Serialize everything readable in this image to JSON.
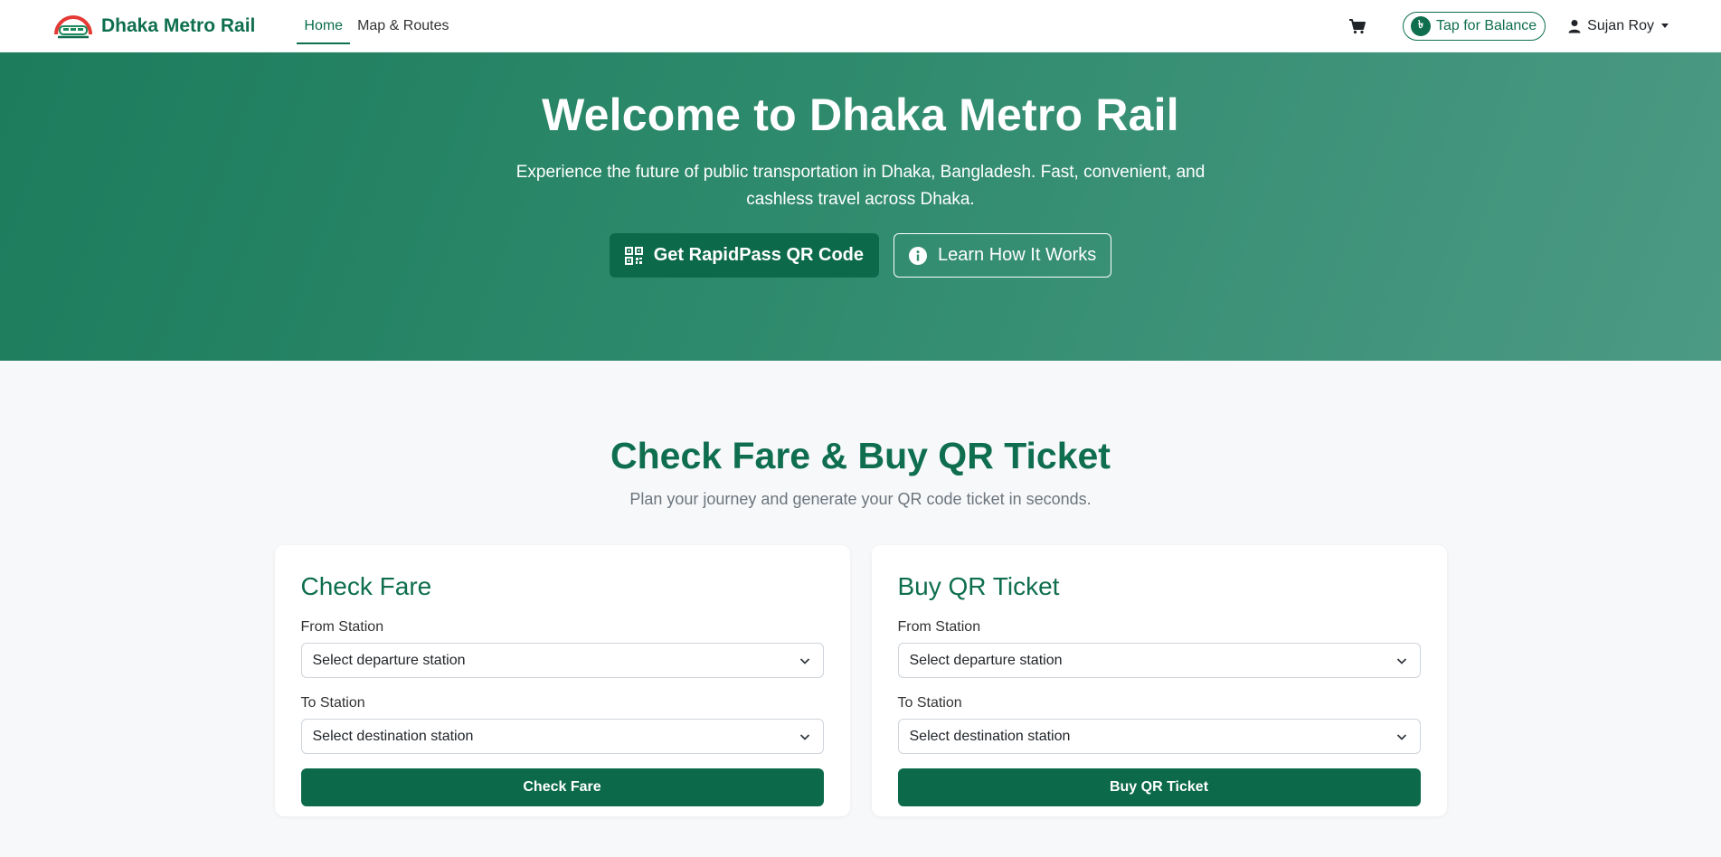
{
  "navbar": {
    "brand": "Dhaka Metro Rail",
    "links": [
      {
        "label": "Home",
        "active": true
      },
      {
        "label": "Map & Routes",
        "active": false
      }
    ],
    "balance_label": "Tap for Balance",
    "balance_icon": "৳",
    "user_name": "Sujan Roy"
  },
  "hero": {
    "title": "Welcome to Dhaka Metro Rail",
    "subtitle": "Experience the future of public transportation in Dhaka, Bangladesh. Fast, convenient, and cashless travel across Dhaka.",
    "primary_button": "Get RapidPass QR Code",
    "secondary_button": "Learn How It Works"
  },
  "section": {
    "title": "Check Fare & Buy QR Ticket",
    "subtitle": "Plan your journey and generate your QR code ticket in seconds."
  },
  "check_fare": {
    "title": "Check Fare",
    "from_label": "From Station",
    "from_value": "Select departure station",
    "to_label": "To Station",
    "to_value": "Select destination station",
    "button": "Check Fare"
  },
  "buy_ticket": {
    "title": "Buy QR Ticket",
    "from_label": "From Station",
    "from_value": "Select departure station",
    "to_label": "To Station",
    "to_value": "Select destination station",
    "button": "Buy QR Ticket"
  },
  "colors": {
    "brand_green": "#0e6e4e",
    "hero_gradient_start": "#1c7c5c",
    "hero_gradient_end": "#4c9a84",
    "background": "#f7f8fa"
  },
  "icons": {
    "logo": "metro-train-logo",
    "cart": "cart-icon",
    "balance": "taka-icon",
    "user": "user-icon",
    "qr": "qr-code-icon",
    "info": "info-icon",
    "select": "chevron-down-icon"
  }
}
